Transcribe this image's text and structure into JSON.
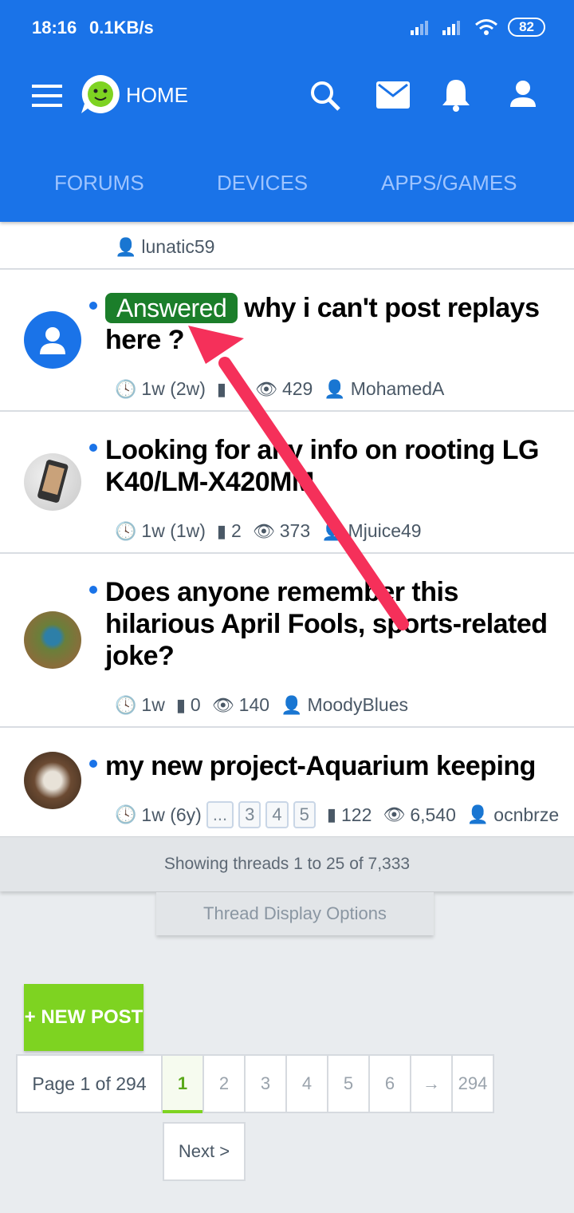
{
  "status": {
    "time": "18:16",
    "speed": "0.1KB/s",
    "battery": "82"
  },
  "header": {
    "home_label": "HOME"
  },
  "tabs": [
    "FORUMS",
    "DEVICES",
    "APPS/GAMES"
  ],
  "threads": [
    {
      "author": "lunatic59"
    },
    {
      "badge": "Answered",
      "title": "why i can't post replays here ?",
      "age": "1w (2w)",
      "views": "429",
      "author": "MohamedA"
    },
    {
      "title": "Looking for any info on rooting LG K40/LM-X420MM",
      "age": "1w (1w)",
      "replies": "2",
      "views": "373",
      "author": "Mjuice49"
    },
    {
      "title": "Does anyone remember this hilarious April Fools, sports-related joke?",
      "age": "1w",
      "replies": "0",
      "views": "140",
      "author": "MoodyBlues"
    },
    {
      "title": "my new project-Aquarium keeping",
      "age": "1w (6y)",
      "pages": [
        "...",
        "3",
        "4",
        "5"
      ],
      "replies": "122",
      "views": "6,540",
      "author": "ocnbrze"
    }
  ],
  "footer": {
    "showing": "Showing threads 1 to 25 of 7,333",
    "display_options": "Thread Display Options"
  },
  "new_post": "+ NEW POST",
  "pagination": {
    "label": "Page 1 of 294",
    "pages": [
      "1",
      "2",
      "3",
      "4",
      "5",
      "6",
      "→",
      "294"
    ],
    "next": "Next >"
  },
  "colors": {
    "primary": "#1a73e8",
    "answered": "#1b7e2a",
    "new_post": "#7ed321",
    "arrow": "#f5305a"
  }
}
